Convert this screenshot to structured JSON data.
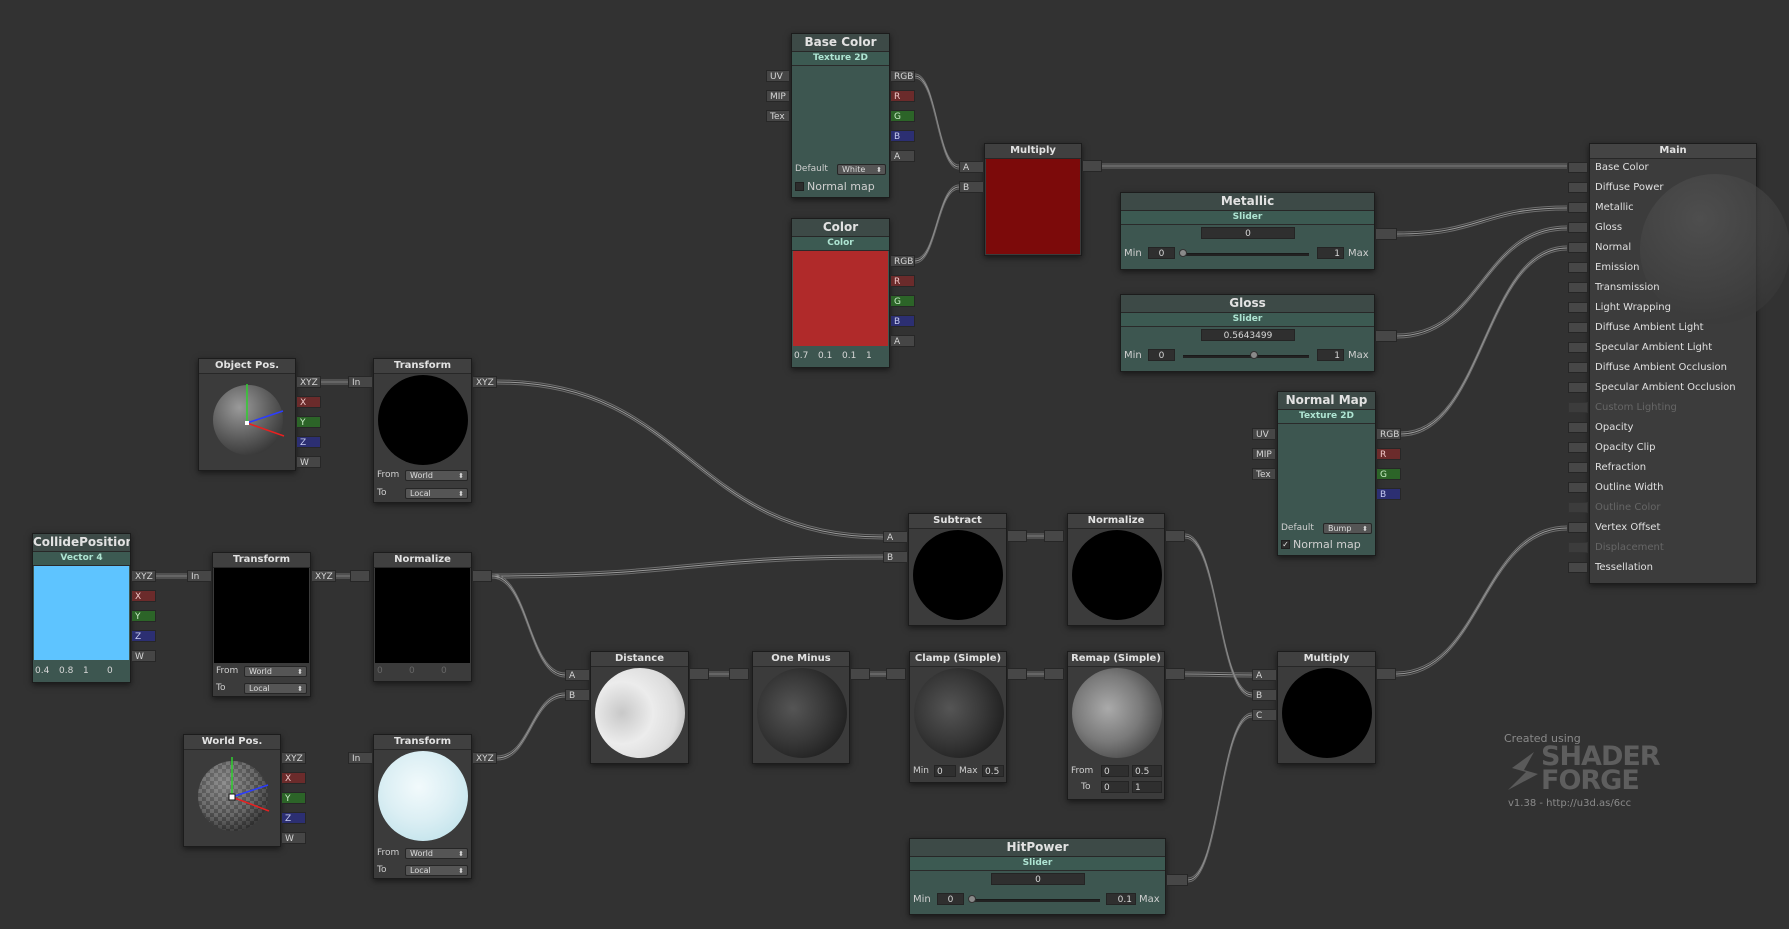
{
  "nodes": {
    "base_color": {
      "title": "Base Color",
      "subtitle": "Texture 2D",
      "inputs": [
        "UV",
        "MIP",
        "Tex"
      ],
      "outputs": [
        "RGB",
        "R",
        "G",
        "B",
        "A"
      ],
      "default_label": "Default",
      "default_value": "White",
      "normal_map": "Normal map"
    },
    "color": {
      "title": "Color",
      "subtitle": "Color",
      "outputs": [
        "RGB",
        "R",
        "G",
        "B",
        "A"
      ],
      "values": [
        "0.7",
        "0.1",
        "0.1",
        "1"
      ],
      "swatch": "#b02a2a"
    },
    "multiply_top": {
      "title": "Multiply",
      "inputs": [
        "A",
        "B"
      ],
      "swatch": "#7c0a0a"
    },
    "metallic": {
      "title": "Metallic",
      "subtitle": "Slider",
      "value": "0",
      "min_label": "Min",
      "min": "0",
      "max": "1",
      "max_label": "Max",
      "level": 0
    },
    "gloss": {
      "title": "Gloss",
      "subtitle": "Slider",
      "value": "0.5643499",
      "min_label": "Min",
      "min": "0",
      "max": "1",
      "max_label": "Max",
      "level": 0.5643499
    },
    "normal_map": {
      "title": "Normal Map",
      "subtitle": "Texture 2D",
      "inputs": [
        "UV",
        "MIP",
        "Tex"
      ],
      "outputs": [
        "RGB",
        "R",
        "G",
        "B"
      ],
      "default_label": "Default",
      "default_value": "Bump",
      "normal_map": "Normal map"
    },
    "main": {
      "title": "Main",
      "inputs": [
        {
          "label": "Base Color",
          "enabled": true
        },
        {
          "label": "Diffuse Power",
          "enabled": true
        },
        {
          "label": "Metallic",
          "enabled": true
        },
        {
          "label": "Gloss",
          "enabled": true
        },
        {
          "label": "Normal",
          "enabled": true
        },
        {
          "label": "Emission",
          "enabled": true
        },
        {
          "label": "Transmission",
          "enabled": true
        },
        {
          "label": "Light Wrapping",
          "enabled": true
        },
        {
          "label": "Diffuse Ambient Light",
          "enabled": true
        },
        {
          "label": "Specular Ambient Light",
          "enabled": true
        },
        {
          "label": "Diffuse Ambient Occlusion",
          "enabled": true
        },
        {
          "label": "Specular Ambient Occlusion",
          "enabled": true
        },
        {
          "label": "Custom Lighting",
          "enabled": false
        },
        {
          "label": "Opacity",
          "enabled": true
        },
        {
          "label": "Opacity Clip",
          "enabled": true
        },
        {
          "label": "Refraction",
          "enabled": true
        },
        {
          "label": "Outline Width",
          "enabled": true
        },
        {
          "label": "Outline Color",
          "enabled": false
        },
        {
          "label": "Vertex Offset",
          "enabled": true
        },
        {
          "label": "Displacement",
          "enabled": false
        },
        {
          "label": "Tessellation",
          "enabled": true
        }
      ]
    },
    "object_pos": {
      "title": "Object Pos.",
      "outputs": [
        "XYZ",
        "X",
        "Y",
        "Z",
        "W"
      ]
    },
    "transform1": {
      "title": "Transform",
      "input": "In",
      "output": "XYZ",
      "from_label": "From",
      "from": "World",
      "to_label": "To",
      "to": "Local"
    },
    "subtract": {
      "title": "Subtract",
      "inputs": [
        "A",
        "B"
      ]
    },
    "normalize2": {
      "title": "Normalize"
    },
    "collide_position": {
      "title": "CollidePosition",
      "subtitle": "Vector 4",
      "outputs": [
        "XYZ",
        "X",
        "Y",
        "Z",
        "W"
      ],
      "values": [
        "0.4",
        "0.8",
        "1",
        "0"
      ],
      "swatch": "#5ec4ff"
    },
    "transform2": {
      "title": "Transform",
      "input": "In",
      "output": "XYZ",
      "from_label": "From",
      "from": "World",
      "to_label": "To",
      "to": "Local"
    },
    "normalize1": {
      "title": "Normalize",
      "values": [
        "0",
        "0",
        "0"
      ]
    },
    "distance": {
      "title": "Distance",
      "inputs": [
        "A",
        "B"
      ]
    },
    "one_minus": {
      "title": "One Minus"
    },
    "clamp": {
      "title": "Clamp (Simple)",
      "min_label": "Min",
      "min": "0",
      "max_label": "Max",
      "max": "0.5"
    },
    "remap": {
      "title": "Remap (Simple)",
      "from_label": "From",
      "from_a": "0",
      "from_b": "0.5",
      "to_label": "To",
      "to_a": "0",
      "to_b": "1"
    },
    "multiply_bottom": {
      "title": "Multiply",
      "inputs": [
        "A",
        "B",
        "C"
      ]
    },
    "world_pos": {
      "title": "World Pos.",
      "outputs": [
        "XYZ",
        "X",
        "Y",
        "Z",
        "W"
      ]
    },
    "transform3": {
      "title": "Transform",
      "input": "In",
      "output": "XYZ",
      "from_label": "From",
      "from": "World",
      "to_label": "To",
      "to": "Local"
    },
    "hitpower": {
      "title": "HitPower",
      "subtitle": "Slider",
      "value": "0",
      "min_label": "Min",
      "min": "0",
      "max": "0.1",
      "max_label": "Max",
      "level": 0
    }
  },
  "credit": {
    "created_using": "Created using",
    "logo_line1": "SHADER",
    "logo_line2": "FORGE",
    "version": "v1.38 - http://u3d.as/6cc"
  },
  "colors": {
    "background": "#323232",
    "wire": "#8c8c8c",
    "param_node": "#3d5650"
  }
}
